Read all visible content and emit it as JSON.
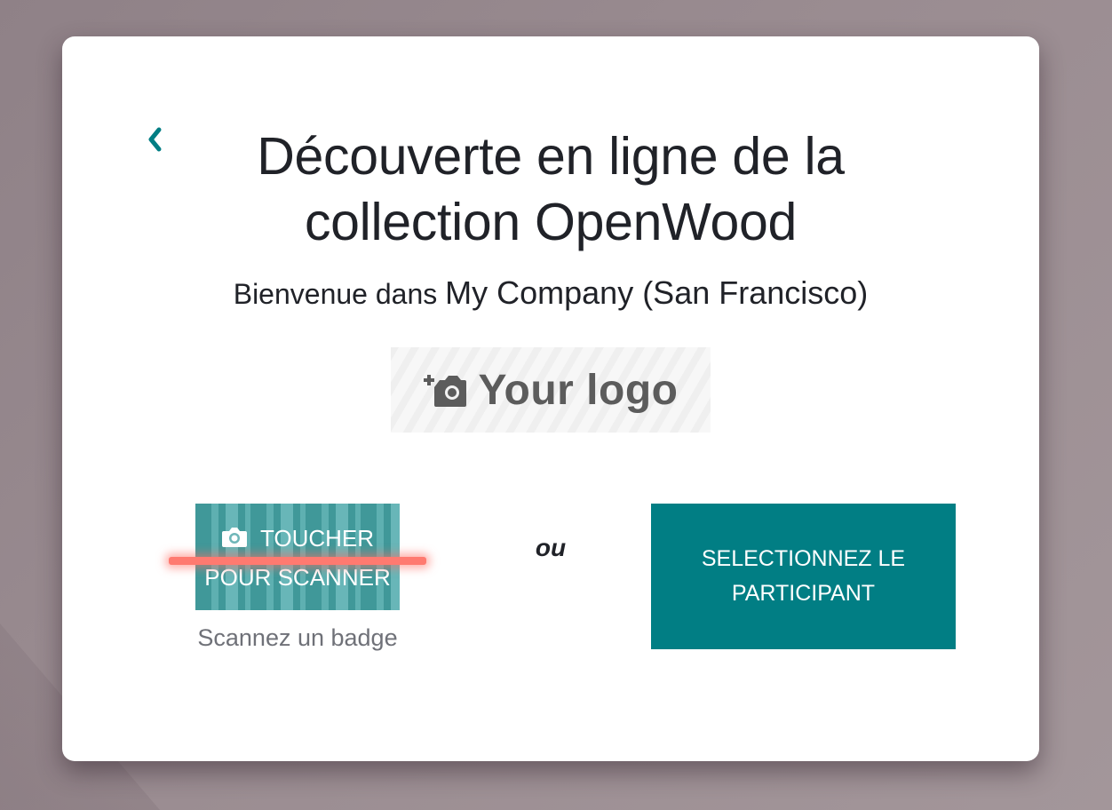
{
  "header": {
    "title": "Découverte en ligne de la collection OpenWood",
    "welcome_prefix": "Bienvenue dans",
    "company": "My Company (San Francisco)"
  },
  "logo": {
    "icon": "add-photo-icon",
    "text": "Your logo"
  },
  "scanner": {
    "button_label": "TOUCHER POUR SCANNER",
    "icon": "camera-icon",
    "caption": "Scannez un badge"
  },
  "separator": "ou",
  "select_button": {
    "label": "SELECTIONNEZ LE PARTICIPANT"
  },
  "colors": {
    "accent": "#017e84",
    "laser": "#ff7a70",
    "title_text": "#202228",
    "muted_text": "#6f7178"
  }
}
